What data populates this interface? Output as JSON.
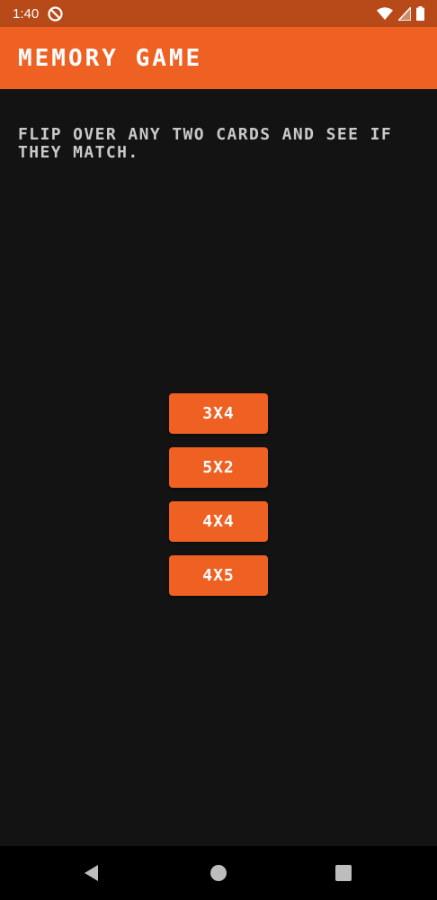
{
  "status_bar": {
    "time": "1:40",
    "icons": [
      "do-not-disturb-icon",
      "wifi-icon",
      "signal-icon",
      "battery-icon"
    ]
  },
  "app_bar": {
    "title": "Memory Game",
    "background_color": "#ef6123"
  },
  "instructions": "Flip over any two cards and see if they match.",
  "options": [
    {
      "label": "3X4"
    },
    {
      "label": "5X2"
    },
    {
      "label": "4X4"
    },
    {
      "label": "4X5"
    }
  ],
  "navigation": {
    "buttons": [
      "back-icon",
      "home-icon",
      "recents-icon"
    ]
  },
  "colors": {
    "accent": "#ef6123",
    "status_bar": "#b84a1a",
    "background": "#131313",
    "text_secondary": "#c9c9c9"
  }
}
